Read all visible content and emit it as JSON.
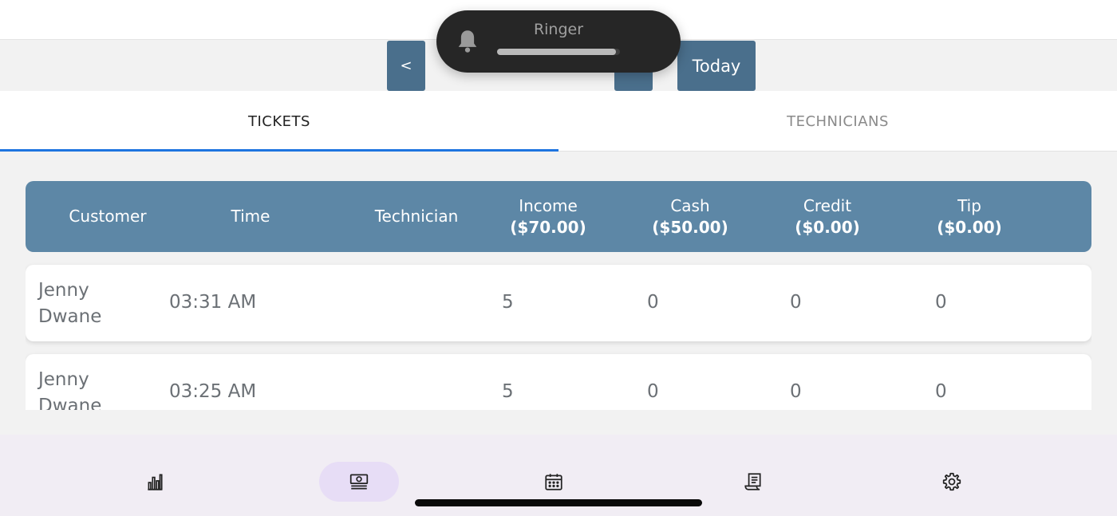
{
  "date_nav": {
    "prev_label": "<",
    "date_text": "",
    "next_label": "",
    "today_label": "Today"
  },
  "toast": {
    "title": "Ringer",
    "icon": "bell-icon",
    "level": 0.97
  },
  "tabs": [
    {
      "label": "TICKETS",
      "active": true
    },
    {
      "label": "TECHNICIANS",
      "active": false
    }
  ],
  "table": {
    "columns": {
      "customer": {
        "label": "Customer"
      },
      "time": {
        "label": "Time"
      },
      "technician": {
        "label": "Technician"
      },
      "income": {
        "label": "Income",
        "total": "($70.00)"
      },
      "cash": {
        "label": "Cash",
        "total": "($50.00)"
      },
      "credit": {
        "label": "Credit",
        "total": "($0.00)"
      },
      "tip": {
        "label": "Tip",
        "total": "($0.00)"
      }
    },
    "rows": [
      {
        "customer": "Jenny Dwane",
        "time": "03:31 AM",
        "technician": "",
        "income": "5",
        "cash": "0",
        "credit": "0",
        "tip": "0"
      },
      {
        "customer": "Jenny Dwane",
        "time": "03:25 AM",
        "technician": "",
        "income": "5",
        "cash": "0",
        "credit": "0",
        "tip": "0"
      }
    ]
  },
  "bottom_nav": [
    {
      "icon": "bar-chart-icon",
      "active": false
    },
    {
      "icon": "cash-icon",
      "active": true
    },
    {
      "icon": "calendar-icon",
      "active": false
    },
    {
      "icon": "receipt-icon",
      "active": false
    },
    {
      "icon": "gear-icon",
      "active": false
    }
  ],
  "colors": {
    "header_bg": "#5d87a6",
    "button_bg": "#4a6f8c",
    "tab_underline": "#1e74e0",
    "nav_active_bg": "#e7ddf6"
  }
}
